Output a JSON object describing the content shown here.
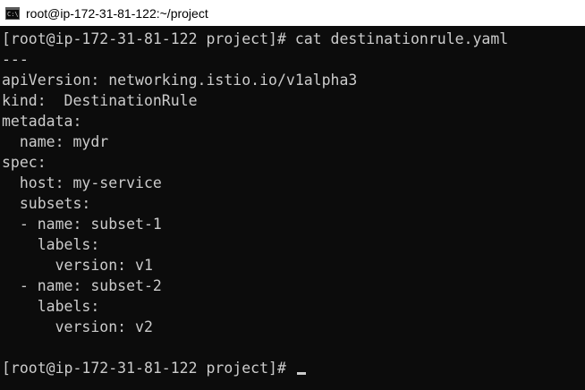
{
  "window": {
    "title": "root@ip-172-31-81-122:~/project",
    "icon_name": "command-prompt-icon",
    "icon_text": "C:\\"
  },
  "terminal": {
    "lines": [
      "[root@ip-172-31-81-122 project]# cat destinationrule.yaml",
      "---",
      "apiVersion: networking.istio.io/v1alpha3",
      "kind:  DestinationRule",
      "metadata:",
      "  name: mydr",
      "spec:",
      "  host: my-service",
      "  subsets:",
      "  - name: subset-1",
      "    labels:",
      "      version: v1",
      "  - name: subset-2",
      "    labels:",
      "      version: v2",
      ""
    ],
    "prompt": "[root@ip-172-31-81-122 project]# "
  },
  "colors": {
    "background": "#0c0c0c",
    "foreground": "#cccccc",
    "titlebar": "#ffffff"
  }
}
